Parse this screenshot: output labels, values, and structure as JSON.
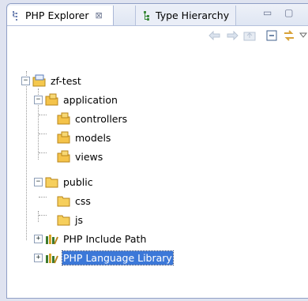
{
  "tabs": {
    "active_label": "PHP Explorer",
    "active_close": "⊠",
    "inactive_label": "Type Hierarchy"
  },
  "window_controls": "▭ ▢",
  "tree": {
    "root": "zf-test",
    "application": "application",
    "controllers": "controllers",
    "models": "models",
    "views": "views",
    "public": "public",
    "css": "css",
    "js": "js",
    "include_path": "PHP Include Path",
    "language_library": "PHP Language Library"
  },
  "colors": {
    "selection": "#3c78d8",
    "folder": "#f4c34a",
    "library": "#3c7a2f"
  }
}
